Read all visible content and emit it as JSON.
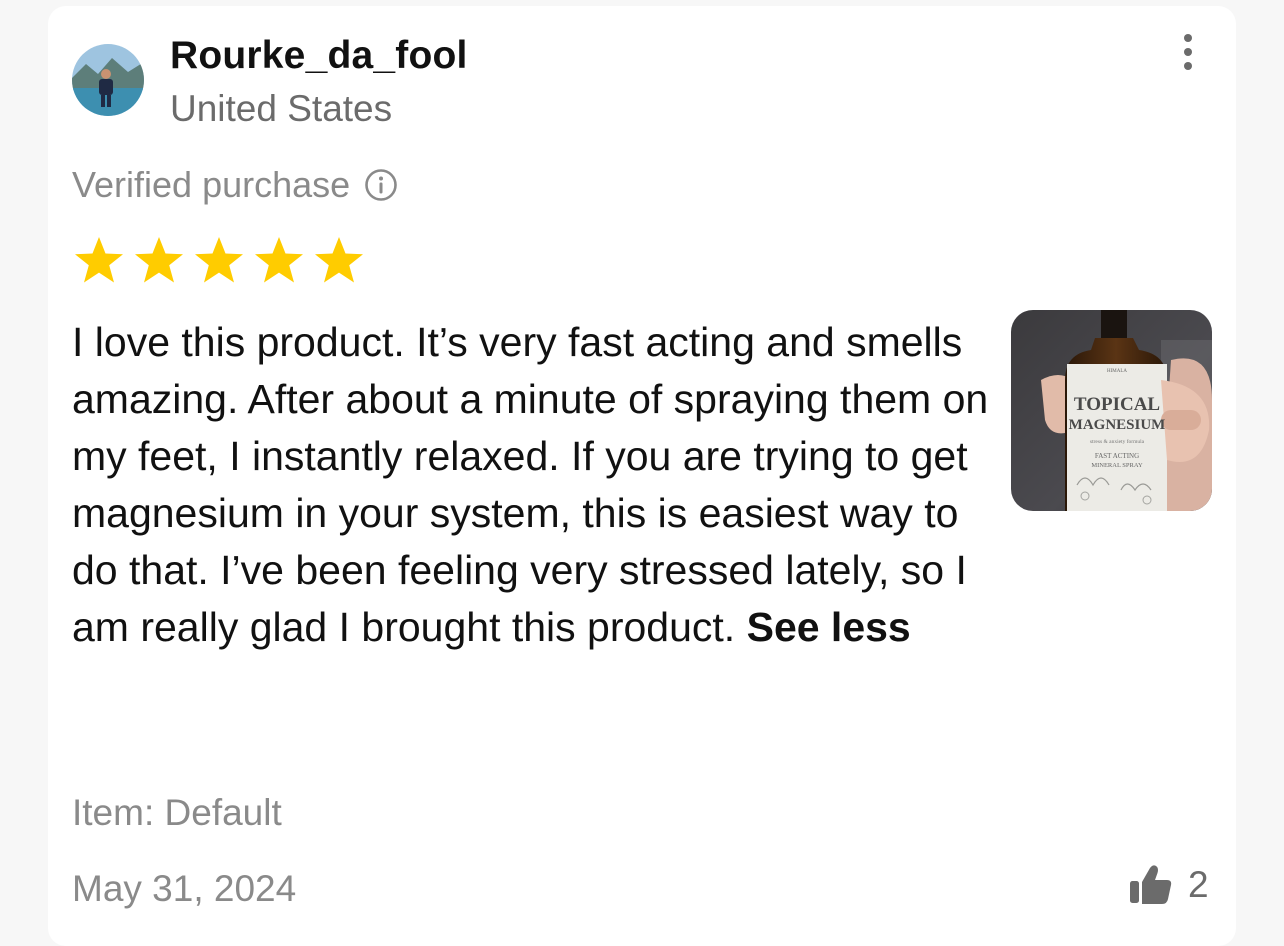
{
  "review": {
    "username": "Rourke_da_fool",
    "country": "United States",
    "verified_label": "Verified purchase",
    "rating": 5,
    "rating_max": 5,
    "text": "I love this product. It’s very fast acting and smells amazing. After about a minute of spraying them on my feet, I instantly relaxed. If you are trying to get magnesium in your system, this is easiest way to do that. I’ve been feeling very stressed lately, so I am really glad I brought this product.",
    "see_less_label": "See less",
    "photo_label": {
      "line1": "TOPICAL",
      "line2": "MAGNESIUM",
      "line3": "stress & anxiety formula",
      "line4": "FAST ACTING",
      "line5": "MINERAL SPRAY"
    },
    "item": "Item: Default",
    "date": "May 31, 2024",
    "helpful_count": "2"
  },
  "colors": {
    "star": "#FFCC00",
    "text": "#111111",
    "muted": "#8a8a8a"
  },
  "icons": {
    "info": "info-circle-icon",
    "more": "more-vertical-icon",
    "helpful": "thumbs-up-icon",
    "star": "star-icon"
  }
}
